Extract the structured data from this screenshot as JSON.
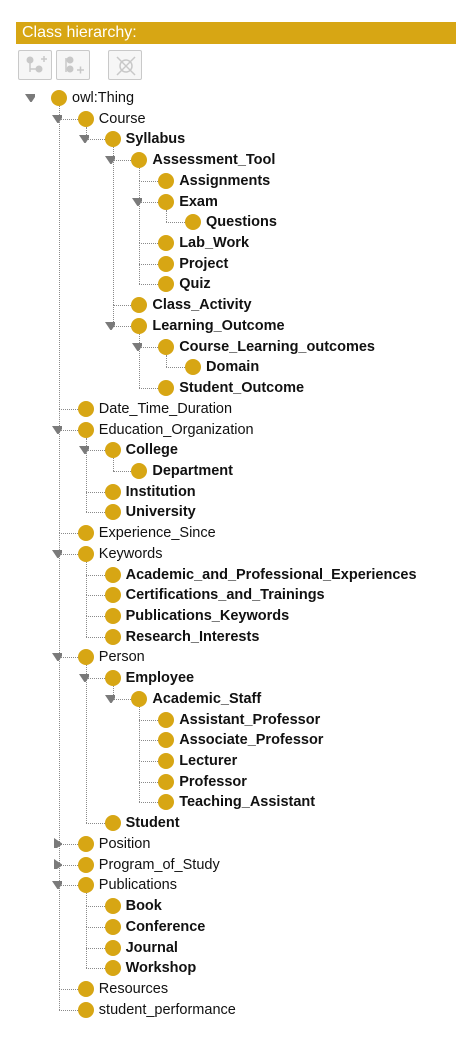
{
  "panel": {
    "title": "Class hierarchy:"
  },
  "toolbar": {
    "buttons": [
      "add-subclass-icon",
      "add-sibling-icon",
      "delete-class-icon"
    ]
  },
  "accent_color": "#d7a614",
  "tree": [
    {
      "label": "owl:Thing",
      "depth": 0,
      "expand": "expanded",
      "bold": false,
      "more": false
    },
    {
      "label": "Course",
      "depth": 1,
      "expand": "expanded",
      "bold": false,
      "more": true
    },
    {
      "label": "Syllabus",
      "depth": 2,
      "expand": "expanded",
      "bold": true,
      "more": false
    },
    {
      "label": "Assessment_Tool",
      "depth": 3,
      "expand": "expanded",
      "bold": true,
      "more": true
    },
    {
      "label": "Assignments",
      "depth": 4,
      "expand": "none",
      "bold": true,
      "more": true
    },
    {
      "label": "Exam",
      "depth": 4,
      "expand": "expanded",
      "bold": true,
      "more": true
    },
    {
      "label": "Questions",
      "depth": 5,
      "expand": "none",
      "bold": true,
      "more": false
    },
    {
      "label": "Lab_Work",
      "depth": 4,
      "expand": "none",
      "bold": true,
      "more": true
    },
    {
      "label": "Project",
      "depth": 4,
      "expand": "none",
      "bold": true,
      "more": true
    },
    {
      "label": "Quiz",
      "depth": 4,
      "expand": "none",
      "bold": true,
      "more": false
    },
    {
      "label": "Class_Activity",
      "depth": 3,
      "expand": "none",
      "bold": true,
      "more": true
    },
    {
      "label": "Learning_Outcome",
      "depth": 3,
      "expand": "expanded",
      "bold": true,
      "more": false
    },
    {
      "label": "Course_Learning_outcomes",
      "depth": 4,
      "expand": "expanded",
      "bold": true,
      "more": true
    },
    {
      "label": "Domain",
      "depth": 5,
      "expand": "none",
      "bold": true,
      "more": false
    },
    {
      "label": "Student_Outcome",
      "depth": 4,
      "expand": "none",
      "bold": true,
      "more": false
    },
    {
      "label": "Date_Time_Duration",
      "depth": 1,
      "expand": "none",
      "bold": false,
      "more": true
    },
    {
      "label": "Education_Organization",
      "depth": 1,
      "expand": "expanded",
      "bold": false,
      "more": true
    },
    {
      "label": "College",
      "depth": 2,
      "expand": "expanded",
      "bold": true,
      "more": true
    },
    {
      "label": "Department",
      "depth": 3,
      "expand": "none",
      "bold": true,
      "more": false
    },
    {
      "label": "Institution",
      "depth": 2,
      "expand": "none",
      "bold": true,
      "more": true
    },
    {
      "label": "University",
      "depth": 2,
      "expand": "none",
      "bold": true,
      "more": false
    },
    {
      "label": "Experience_Since",
      "depth": 1,
      "expand": "none",
      "bold": false,
      "more": true
    },
    {
      "label": "Keywords",
      "depth": 1,
      "expand": "expanded",
      "bold": false,
      "more": true
    },
    {
      "label": "Academic_and_Professional_Experiences",
      "depth": 2,
      "expand": "none",
      "bold": true,
      "more": true
    },
    {
      "label": "Certifications_and_Trainings",
      "depth": 2,
      "expand": "none",
      "bold": true,
      "more": true
    },
    {
      "label": "Publications_Keywords",
      "depth": 2,
      "expand": "none",
      "bold": true,
      "more": true
    },
    {
      "label": "Research_Interests",
      "depth": 2,
      "expand": "none",
      "bold": true,
      "more": false
    },
    {
      "label": "Person",
      "depth": 1,
      "expand": "expanded",
      "bold": false,
      "more": true
    },
    {
      "label": "Employee",
      "depth": 2,
      "expand": "expanded",
      "bold": true,
      "more": true
    },
    {
      "label": "Academic_Staff",
      "depth": 3,
      "expand": "expanded",
      "bold": true,
      "more": false
    },
    {
      "label": "Assistant_Professor",
      "depth": 4,
      "expand": "none",
      "bold": true,
      "more": true
    },
    {
      "label": "Associate_Professor",
      "depth": 4,
      "expand": "none",
      "bold": true,
      "more": true
    },
    {
      "label": "Lecturer",
      "depth": 4,
      "expand": "none",
      "bold": true,
      "more": true
    },
    {
      "label": "Professor",
      "depth": 4,
      "expand": "none",
      "bold": true,
      "more": true
    },
    {
      "label": "Teaching_Assistant",
      "depth": 4,
      "expand": "none",
      "bold": true,
      "more": false
    },
    {
      "label": "Student",
      "depth": 2,
      "expand": "none",
      "bold": true,
      "more": false
    },
    {
      "label": "Position",
      "depth": 1,
      "expand": "collapsed",
      "bold": false,
      "more": true
    },
    {
      "label": "Program_of_Study",
      "depth": 1,
      "expand": "collapsed",
      "bold": false,
      "more": true
    },
    {
      "label": "Publications",
      "depth": 1,
      "expand": "expanded",
      "bold": false,
      "more": true
    },
    {
      "label": "Book",
      "depth": 2,
      "expand": "none",
      "bold": true,
      "more": true
    },
    {
      "label": "Conference",
      "depth": 2,
      "expand": "none",
      "bold": true,
      "more": true
    },
    {
      "label": "Journal",
      "depth": 2,
      "expand": "none",
      "bold": true,
      "more": true
    },
    {
      "label": "Workshop",
      "depth": 2,
      "expand": "none",
      "bold": true,
      "more": false
    },
    {
      "label": "Resources",
      "depth": 1,
      "expand": "none",
      "bold": false,
      "more": true
    },
    {
      "label": "student_performance",
      "depth": 1,
      "expand": "none",
      "bold": false,
      "more": false
    }
  ]
}
